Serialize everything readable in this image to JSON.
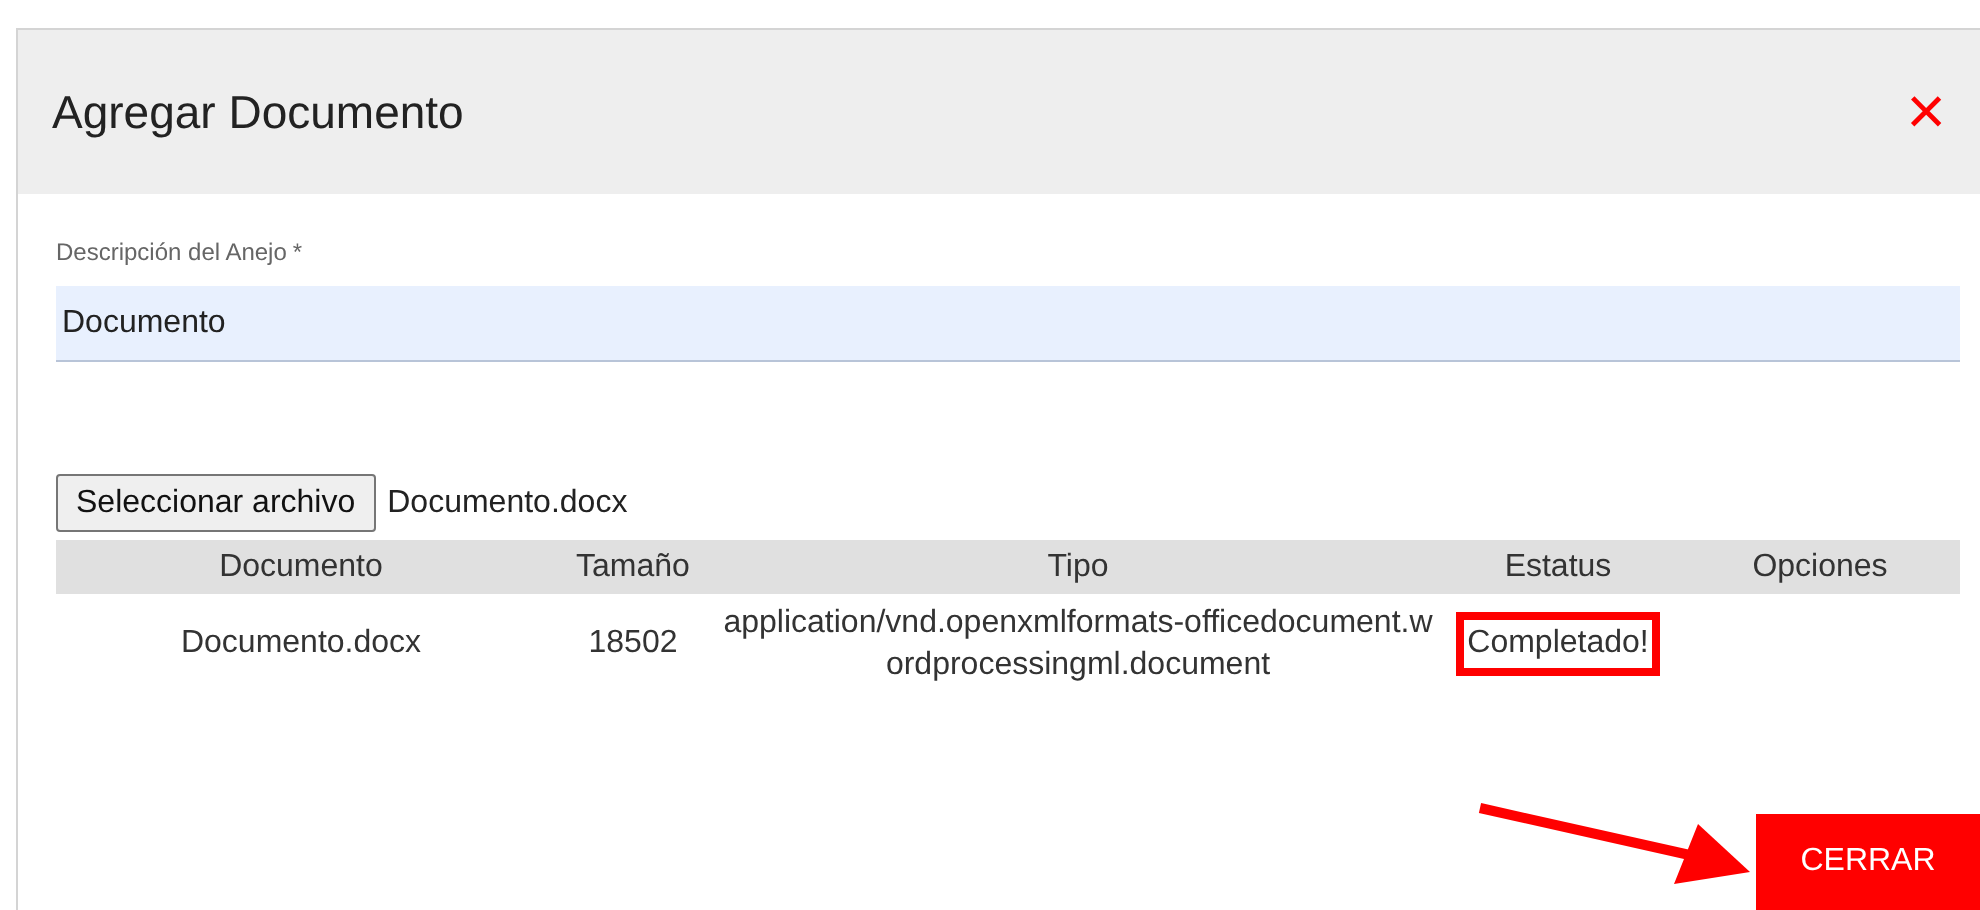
{
  "dialog": {
    "title": "Agregar Documento",
    "close": "×"
  },
  "field": {
    "label": "Descripción del Anejo",
    "required_mark": "*",
    "value": "Documento"
  },
  "file_picker": {
    "button": "Seleccionar archivo",
    "filename": "Documento.docx"
  },
  "table": {
    "columns": [
      "Documento",
      "Tamaño",
      "Tipo",
      "Estatus",
      "Opciones"
    ],
    "rows": [
      {
        "cells": [
          "Documento.docx",
          "18502",
          "application/vnd.openxmlformats-officedocument.wordprocessingml.document",
          "Completado!"
        ],
        "highlighted": true
      }
    ]
  },
  "close_button": "CERRAR"
}
